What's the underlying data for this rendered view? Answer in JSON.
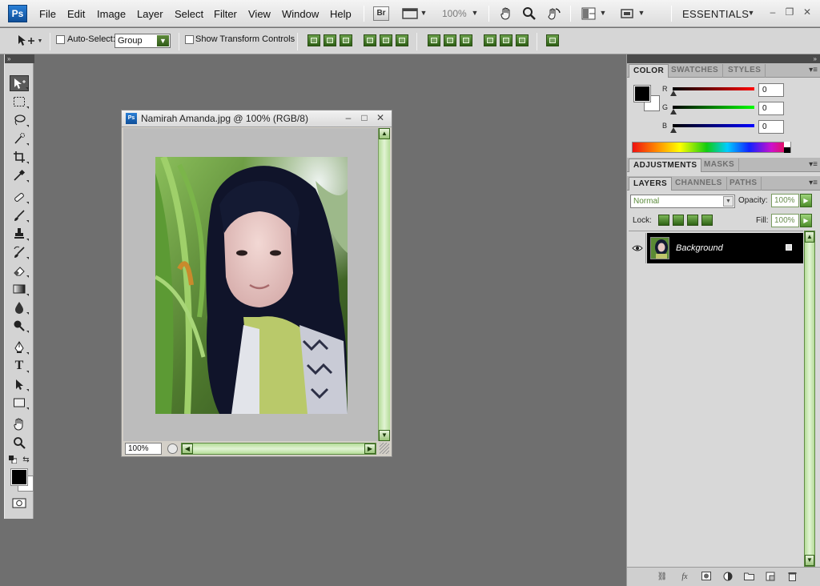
{
  "app": {
    "logo": "Ps",
    "menu": [
      "File",
      "Edit",
      "Image",
      "Layer",
      "Select",
      "Filter",
      "View",
      "Window",
      "Help"
    ],
    "bridge_label": "Br",
    "zoom": "100%",
    "workspace": "ESSENTIALS",
    "icons": [
      "bridge-icon",
      "screen-mode-icon",
      "hand-icon",
      "zoom-icon",
      "rotate-view-icon",
      "arrange-documents-icon",
      "workspace-icon"
    ]
  },
  "options": {
    "auto_select_label": "Auto-Select:",
    "auto_select_checked": false,
    "auto_select_value": "Group",
    "show_transform_label": "Show Transform Controls",
    "show_transform_checked": false
  },
  "tools": [
    "move",
    "marquee",
    "lasso",
    "quick-selection",
    "crop",
    "eyedropper",
    "healing-brush",
    "brush",
    "clone-stamp",
    "history-brush",
    "eraser",
    "gradient",
    "blur",
    "dodge",
    "pen",
    "type",
    "path-selection",
    "rectangle",
    "hand",
    "zoom"
  ],
  "colors": {
    "foreground": "#000000",
    "background": "#ffffff",
    "accent_green": "#3d7a1f"
  },
  "document": {
    "title": "Namirah Amanda.jpg @ 100% (RGB/8)",
    "zoom": "100%"
  },
  "color_panel": {
    "tabs": [
      "COLOR",
      "SWATCHES",
      "STYLES"
    ],
    "active_tab": "COLOR",
    "channels": [
      {
        "label": "R",
        "value": "0"
      },
      {
        "label": "G",
        "value": "0"
      },
      {
        "label": "B",
        "value": "0"
      }
    ]
  },
  "adjustments_panel": {
    "tabs": [
      "ADJUSTMENTS",
      "MASKS"
    ],
    "active_tab": "ADJUSTMENTS"
  },
  "layers_panel": {
    "tabs": [
      "LAYERS",
      "CHANNELS",
      "PATHS"
    ],
    "active_tab": "LAYERS",
    "blend_mode": "Normal",
    "opacity_label": "Opacity:",
    "opacity": "100%",
    "lock_label": "Lock:",
    "fill_label": "Fill:",
    "fill": "100%",
    "layers": [
      {
        "name": "Background",
        "visible": true,
        "locked": true
      }
    ]
  }
}
